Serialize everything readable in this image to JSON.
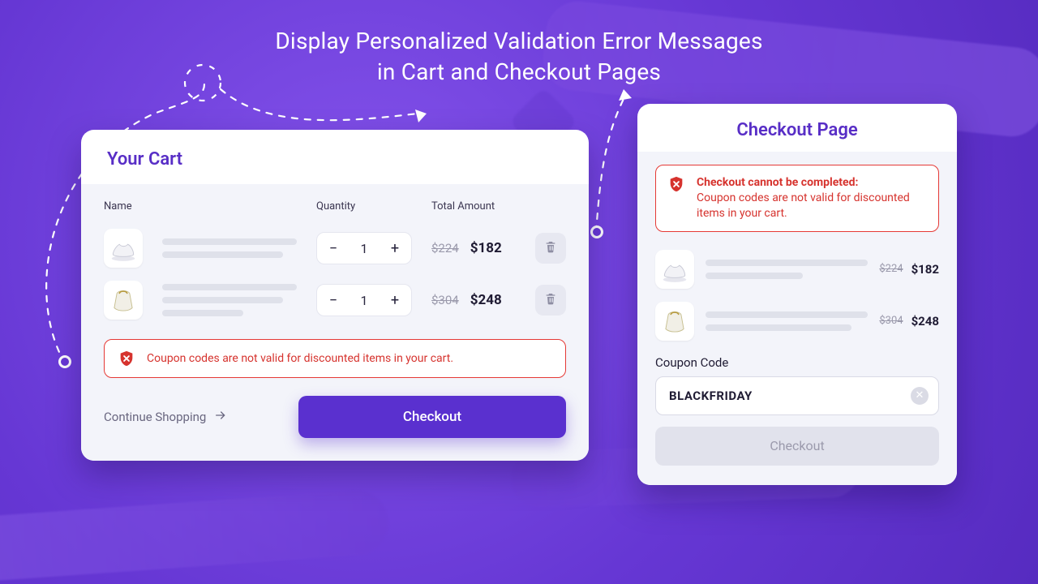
{
  "headline_line1": "Display Personalized Validation Error Messages",
  "headline_line2": "in Cart and Checkout Pages",
  "cart": {
    "title": "Your Cart",
    "columns": {
      "name": "Name",
      "qty": "Quantity",
      "total": "Total Amount"
    },
    "items": [
      {
        "qty": "1",
        "price_old": "$224",
        "price_new": "$182"
      },
      {
        "qty": "1",
        "price_old": "$304",
        "price_new": "$248"
      }
    ],
    "error": "Coupon codes are not valid for discounted items in your cart.",
    "continue_label": "Continue Shopping",
    "checkout_label": "Checkout"
  },
  "checkout": {
    "title": "Checkout Page",
    "error_title": "Checkout cannot be completed:",
    "error_body": "Coupon codes are not valid for discounted items in your cart.",
    "items": [
      {
        "price_old": "$224",
        "price_new": "$182"
      },
      {
        "price_old": "$304",
        "price_new": "$248"
      }
    ],
    "coupon_label": "Coupon Code",
    "coupon_value": "BLACKFRIDAY",
    "checkout_label": "Checkout"
  }
}
